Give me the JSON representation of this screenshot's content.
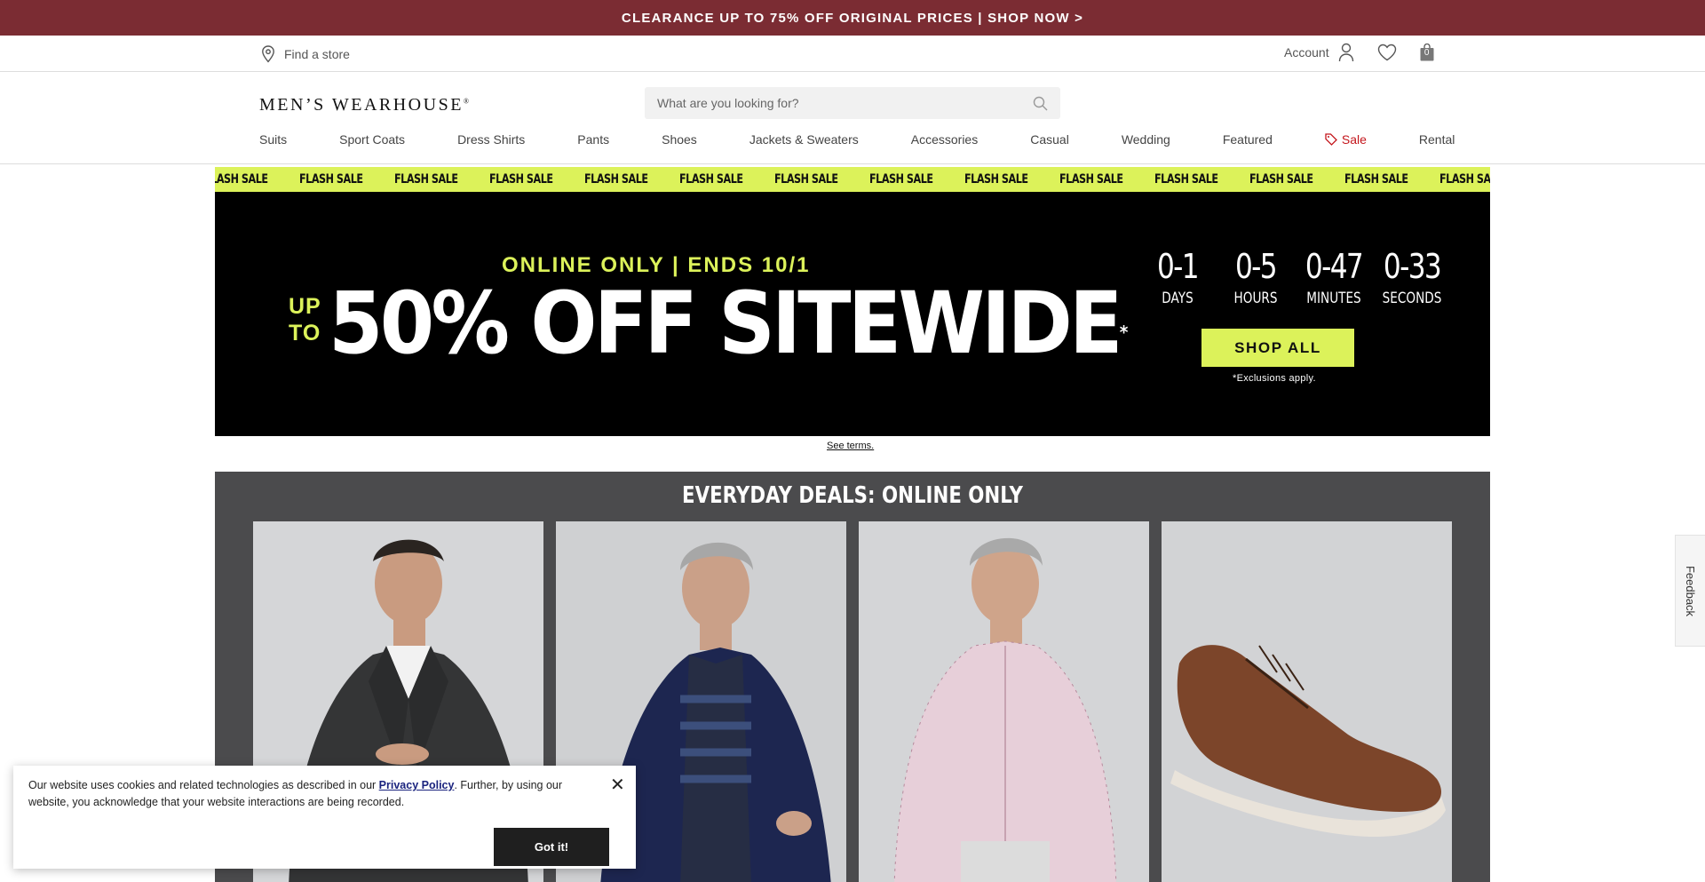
{
  "promo": {
    "text": "CLEARANCE UP TO 75% OFF ORIGINAL PRICES | SHOP NOW >"
  },
  "utility": {
    "store_label": "Find a store",
    "account_label": "Account",
    "bag_count": "0"
  },
  "header": {
    "logo": "MEN’S WEARHOUSE",
    "logo_mark": "®",
    "search_placeholder": "What are you looking for?"
  },
  "nav": {
    "items": [
      "Suits",
      "Sport Coats",
      "Dress Shirts",
      "Pants",
      "Shoes",
      "Jackets & Sweaters",
      "Accessories",
      "Casual",
      "Wedding",
      "Featured",
      "Sale",
      "Rental"
    ]
  },
  "ticker": {
    "text": "FLASH SALE"
  },
  "hero": {
    "kicker": "ONLINE ONLY | ENDS 10/1",
    "upto_line1": "UP",
    "upto_line2": "TO",
    "headline": "50% OFF SITEWIDE",
    "asterisk": "*",
    "countdown": [
      {
        "value": "0-1",
        "label": "DAYS"
      },
      {
        "value": "0-5",
        "label": "HOURS"
      },
      {
        "value": "0-47",
        "label": "MINUTES"
      },
      {
        "value": "0-33",
        "label": "SECONDS"
      }
    ],
    "cta": "SHOP ALL",
    "exclusions": "*Exclusions apply."
  },
  "terms": {
    "label": "See terms."
  },
  "deals": {
    "title": "EVERYDAY DEALS: ONLINE ONLY"
  },
  "cookie": {
    "text_before": "Our website uses cookies and related technologies as described in our ",
    "link": "Privacy Policy",
    "text_after": ". Further, by using our website, you acknowledge that your website interactions are being recorded.",
    "button": "Got it!",
    "close": "✕"
  },
  "feedback": {
    "label": "Feedback"
  },
  "colors": {
    "promo_bg": "#7b2c33",
    "accent_lime": "#dcf25a",
    "sale_red": "#c4161c",
    "deals_bg": "#4b4b4d"
  }
}
